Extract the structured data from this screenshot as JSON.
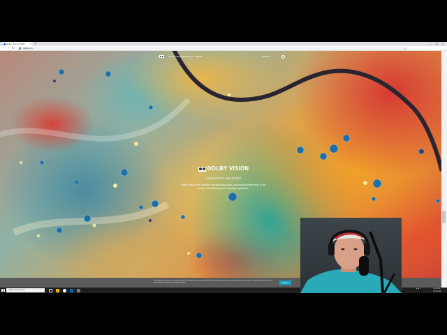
{
  "browser": {
    "tab_title": "Dolby Vision | Dolby",
    "tab_close": "×",
    "new_tab": "+",
    "window_controls": [
      "–",
      "☐",
      "×"
    ],
    "nav_icons": [
      "back-icon",
      "forward-icon",
      "reload-icon"
    ],
    "url": "dolby.com"
  },
  "site": {
    "nav_items": [
      "MOVIES",
      "GAMES",
      "MUSIC",
      "MORE"
    ],
    "sign_in": "SIGN IN",
    "hero": {
      "brand": "DOLBY VISION",
      "subtitle": "CINEMATIC IMAGERY",
      "body": "Dolby Vision HDR delivers extraordinary color, contrast and brightness to the screen, transforming your viewing experience."
    }
  },
  "cookie_banner": {
    "text": "This website uses cookies to ensure you get the best experience on our website. By continuing to browse, you are agreeing to our use of cookies. Learn more about our cookie policy and how to manage your cookie settings.",
    "button": "Accept"
  },
  "taskbar": {
    "search_placeholder": "Type here to search",
    "clock_time": "11:09 AM",
    "clock_date": "1/10/2019"
  },
  "colors": {
    "cookie_button": "#19a5c6",
    "cookie_banner": "#5b5b5b",
    "taskbar": "#1e1e1e"
  }
}
